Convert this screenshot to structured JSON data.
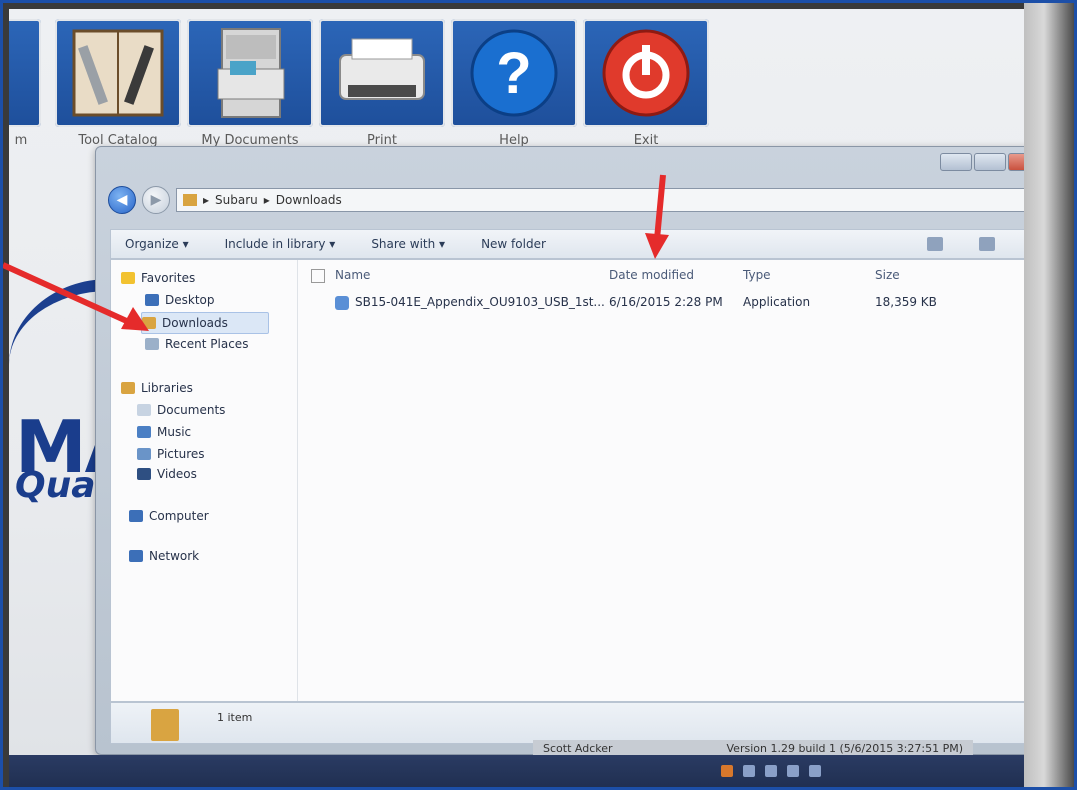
{
  "toolbar": {
    "partial_label": "m",
    "tool_catalog": "Tool Catalog",
    "my_documents": "My Documents",
    "print": "Print",
    "help": "Help",
    "exit": "Exit"
  },
  "logo": {
    "text": "MAS",
    "sub": "Qualit"
  },
  "explorer": {
    "address": {
      "root": "Subaru",
      "sep": "▸",
      "folder": "Downloads",
      "go": "Go"
    },
    "commands": {
      "organize": "Organize ▾",
      "include": "Include in library ▾",
      "share": "Share with ▾",
      "new_folder": "New folder"
    },
    "nav": {
      "favorites": "Favorites",
      "desktop": "Desktop",
      "downloads": "Downloads",
      "recent": "Recent Places",
      "libraries": "Libraries",
      "documents": "Documents",
      "music": "Music",
      "pictures": "Pictures",
      "videos": "Videos",
      "computer": "Computer",
      "network": "Network"
    },
    "columns": {
      "name": "Name",
      "date": "Date modified",
      "type": "Type",
      "size": "Size"
    },
    "file": {
      "name": "SB15-041E_Appendix_OU9103_USB_1st...",
      "date": "6/16/2015 2:28 PM",
      "type": "Application",
      "size": "18,359 KB"
    },
    "status": "1 item"
  },
  "statusbar": {
    "user": "Scott Adcker",
    "version": "Version 1.29 build 1 (5/6/2015 3:27:51 PM)"
  },
  "colors": {
    "accent": "#1e4f9b",
    "arrow": "#e52b2b"
  }
}
